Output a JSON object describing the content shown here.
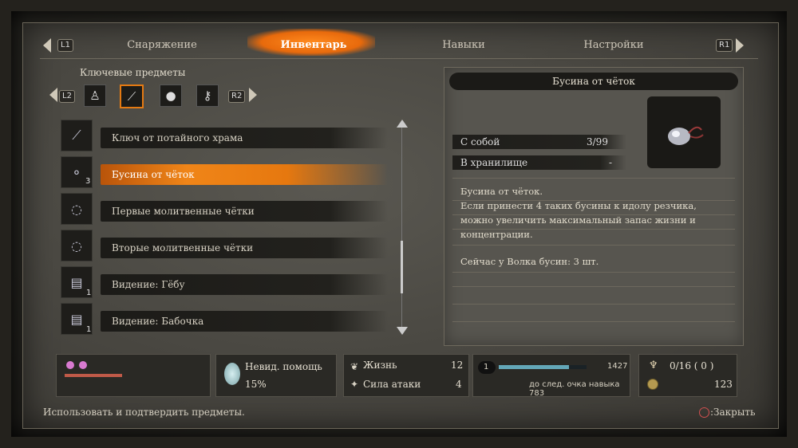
{
  "tabs": {
    "left_button": "L1",
    "right_button": "R1",
    "items": [
      "Снаряжение",
      "Инвентарь",
      "Навыки",
      "Настройки"
    ],
    "active_index": 1
  },
  "category": {
    "title": "Ключевые предметы",
    "left_button": "L2",
    "right_button": "R2",
    "icons": [
      "figurine-icon",
      "tool-icon",
      "pouch-icon",
      "key-icon"
    ],
    "selected_index": 1
  },
  "items": [
    {
      "label": "Ключ от потайного храма",
      "count": "",
      "icon": "key-icon"
    },
    {
      "label": "Бусина от чёток",
      "count": "3",
      "icon": "bead-icon"
    },
    {
      "label": "Первые молитвенные чётки",
      "count": "",
      "icon": "prayer-beads-icon"
    },
    {
      "label": "Вторые молитвенные чётки",
      "count": "",
      "icon": "prayer-beads-icon"
    },
    {
      "label": "Видение: Гёбу",
      "count": "1",
      "icon": "vision-icon"
    },
    {
      "label": "Видение: Бабочка",
      "count": "1",
      "icon": "vision-icon"
    }
  ],
  "selected_item_index": 1,
  "detail": {
    "title": "Бусина от чёток",
    "carried_label": "С собой",
    "carried_value": "3/99",
    "storage_label": "В хранилище",
    "storage_value": "-",
    "description": [
      "Бусина от чёток.",
      "Если принести 4 таких бусины к идолу резчика,",
      "можно увеличить максимальный запас жизни и",
      "концентрации.",
      "",
      "Сейчас у Волка бусин: 3 шт."
    ]
  },
  "hud": {
    "unseen_aid_label": "Невид. помощь",
    "unseen_aid_value": "15%",
    "vitality_label": "Жизнь",
    "vitality_value": "12",
    "attack_label": "Сила атаки",
    "attack_value": "4",
    "skill_level": "1",
    "skill_xp": "1427",
    "skill_next_text": "до след. очка навыка 783",
    "skill_progress": 0.8,
    "spirit_emblems": "0/16 ( 0 )",
    "sen": "123"
  },
  "footer": {
    "hint": "Использовать и подтвердить предметы.",
    "close": ":Закрыть"
  },
  "colors": {
    "accent": "#e9780f",
    "panel": "#4b4943",
    "dark": "#1c1b18"
  }
}
